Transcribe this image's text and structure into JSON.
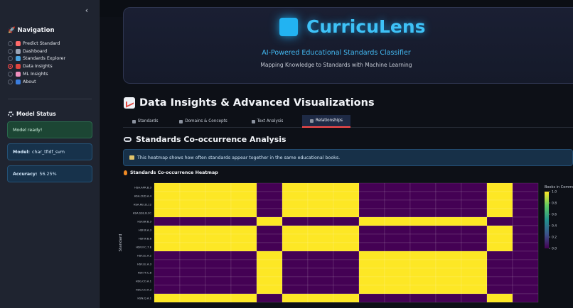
{
  "sidebar": {
    "collapse_glyph": "‹",
    "nav_title": "🚀 Navigation",
    "nav_items": [
      {
        "label": "Predict Standard",
        "icon": "target-icon",
        "color": "#ff6b6b",
        "selected": false
      },
      {
        "label": "Dashboard",
        "icon": "dashboard-icon",
        "color": "#9aa3b5",
        "selected": false
      },
      {
        "label": "Standards Explorer",
        "icon": "search-icon",
        "color": "#4aa3df",
        "selected": false
      },
      {
        "label": "Data Insights",
        "icon": "chart-icon",
        "color": "#e0463f",
        "selected": true
      },
      {
        "label": "ML Insights",
        "icon": "brain-icon",
        "color": "#f08fbf",
        "selected": false
      },
      {
        "label": "About",
        "icon": "info-icon",
        "color": "#3b7ddd",
        "selected": false
      }
    ],
    "status_title": "Model Status",
    "status_ready": "Model ready!",
    "model_label": "Model:",
    "model_value": "char_tfidf_svm",
    "accuracy_label": "Accuracy:",
    "accuracy_value": "56.25%"
  },
  "hero": {
    "brand": "CurricuLens",
    "tagline": "AI-Powered Educational Standards Classifier",
    "subtitle": "Mapping Knowledge to Standards with Machine Learning"
  },
  "page": {
    "title": "Data Insights & Advanced Visualizations",
    "tabs": [
      {
        "label": "Standards",
        "active": false
      },
      {
        "label": "Domains & Concepts",
        "active": false
      },
      {
        "label": "Text Analysis",
        "active": false
      },
      {
        "label": "Relationships",
        "active": true
      }
    ],
    "section_title": "Standards Co-occurrence Analysis",
    "info_text": "This heatmap shows how often standards appear together in the same educational books.",
    "heatmap_title": "Standards Co-occurrence Heatmap"
  },
  "colors": {
    "accent": "#ff4b4b",
    "brand": "#3ec2f7",
    "heat_low": "#440154",
    "heat_high": "#fde725"
  },
  "chart_data": {
    "type": "heatmap",
    "ylabel": "Standard",
    "row_labels": [
      "HSA.APR.B.3",
      "HSA.CED.A.4",
      "HSA.REI.D.12",
      "HSA.SSE.B.3C",
      "HSF.BF.B.3",
      "HSF.IF.A.3",
      "HSF.IF.B.6",
      "HSF.IF.C.7.E",
      "HSF.LE.A.2",
      "HSF.LE.A.3",
      "HSF.TF.C.8",
      "HSG.CO.A.1",
      "HSG.CO.A.3",
      "HSN.Q.A.1"
    ],
    "colorbar": {
      "label": "Books in Common",
      "ticks": [
        1.0,
        0.8,
        0.6,
        0.4,
        0.2,
        0.0
      ],
      "min": 0.0,
      "max": 1.0
    },
    "matrix": [
      [
        1,
        1,
        1,
        1,
        0,
        1,
        1,
        1,
        0,
        0,
        0,
        0,
        0,
        1,
        0
      ],
      [
        1,
        1,
        1,
        1,
        0,
        1,
        1,
        1,
        0,
        0,
        0,
        0,
        0,
        1,
        0
      ],
      [
        1,
        1,
        1,
        1,
        0,
        1,
        1,
        1,
        0,
        0,
        0,
        0,
        0,
        1,
        0
      ],
      [
        1,
        1,
        1,
        1,
        0,
        1,
        1,
        1,
        0,
        0,
        0,
        0,
        0,
        1,
        0
      ],
      [
        0,
        0,
        0,
        0,
        1,
        0,
        0,
        0,
        1,
        1,
        1,
        1,
        1,
        0,
        0
      ],
      [
        1,
        1,
        1,
        1,
        0,
        1,
        1,
        1,
        0,
        0,
        0,
        0,
        0,
        1,
        0
      ],
      [
        1,
        1,
        1,
        1,
        0,
        1,
        1,
        1,
        0,
        0,
        0,
        0,
        0,
        1,
        0
      ],
      [
        1,
        1,
        1,
        1,
        0,
        1,
        1,
        1,
        0,
        0,
        0,
        0,
        0,
        1,
        0
      ],
      [
        0,
        0,
        0,
        0,
        1,
        0,
        0,
        0,
        1,
        1,
        1,
        1,
        1,
        0,
        0
      ],
      [
        0,
        0,
        0,
        0,
        1,
        0,
        0,
        0,
        1,
        1,
        1,
        1,
        1,
        0,
        0
      ],
      [
        0,
        0,
        0,
        0,
        1,
        0,
        0,
        0,
        1,
        1,
        1,
        1,
        1,
        0,
        0
      ],
      [
        0,
        0,
        0,
        0,
        1,
        0,
        0,
        0,
        1,
        1,
        1,
        1,
        1,
        0,
        0
      ],
      [
        0,
        0,
        0,
        0,
        1,
        0,
        0,
        0,
        1,
        1,
        1,
        1,
        1,
        0,
        0
      ],
      [
        1,
        1,
        1,
        1,
        0,
        1,
        1,
        1,
        0,
        0,
        0,
        0,
        0,
        1,
        0
      ]
    ]
  }
}
